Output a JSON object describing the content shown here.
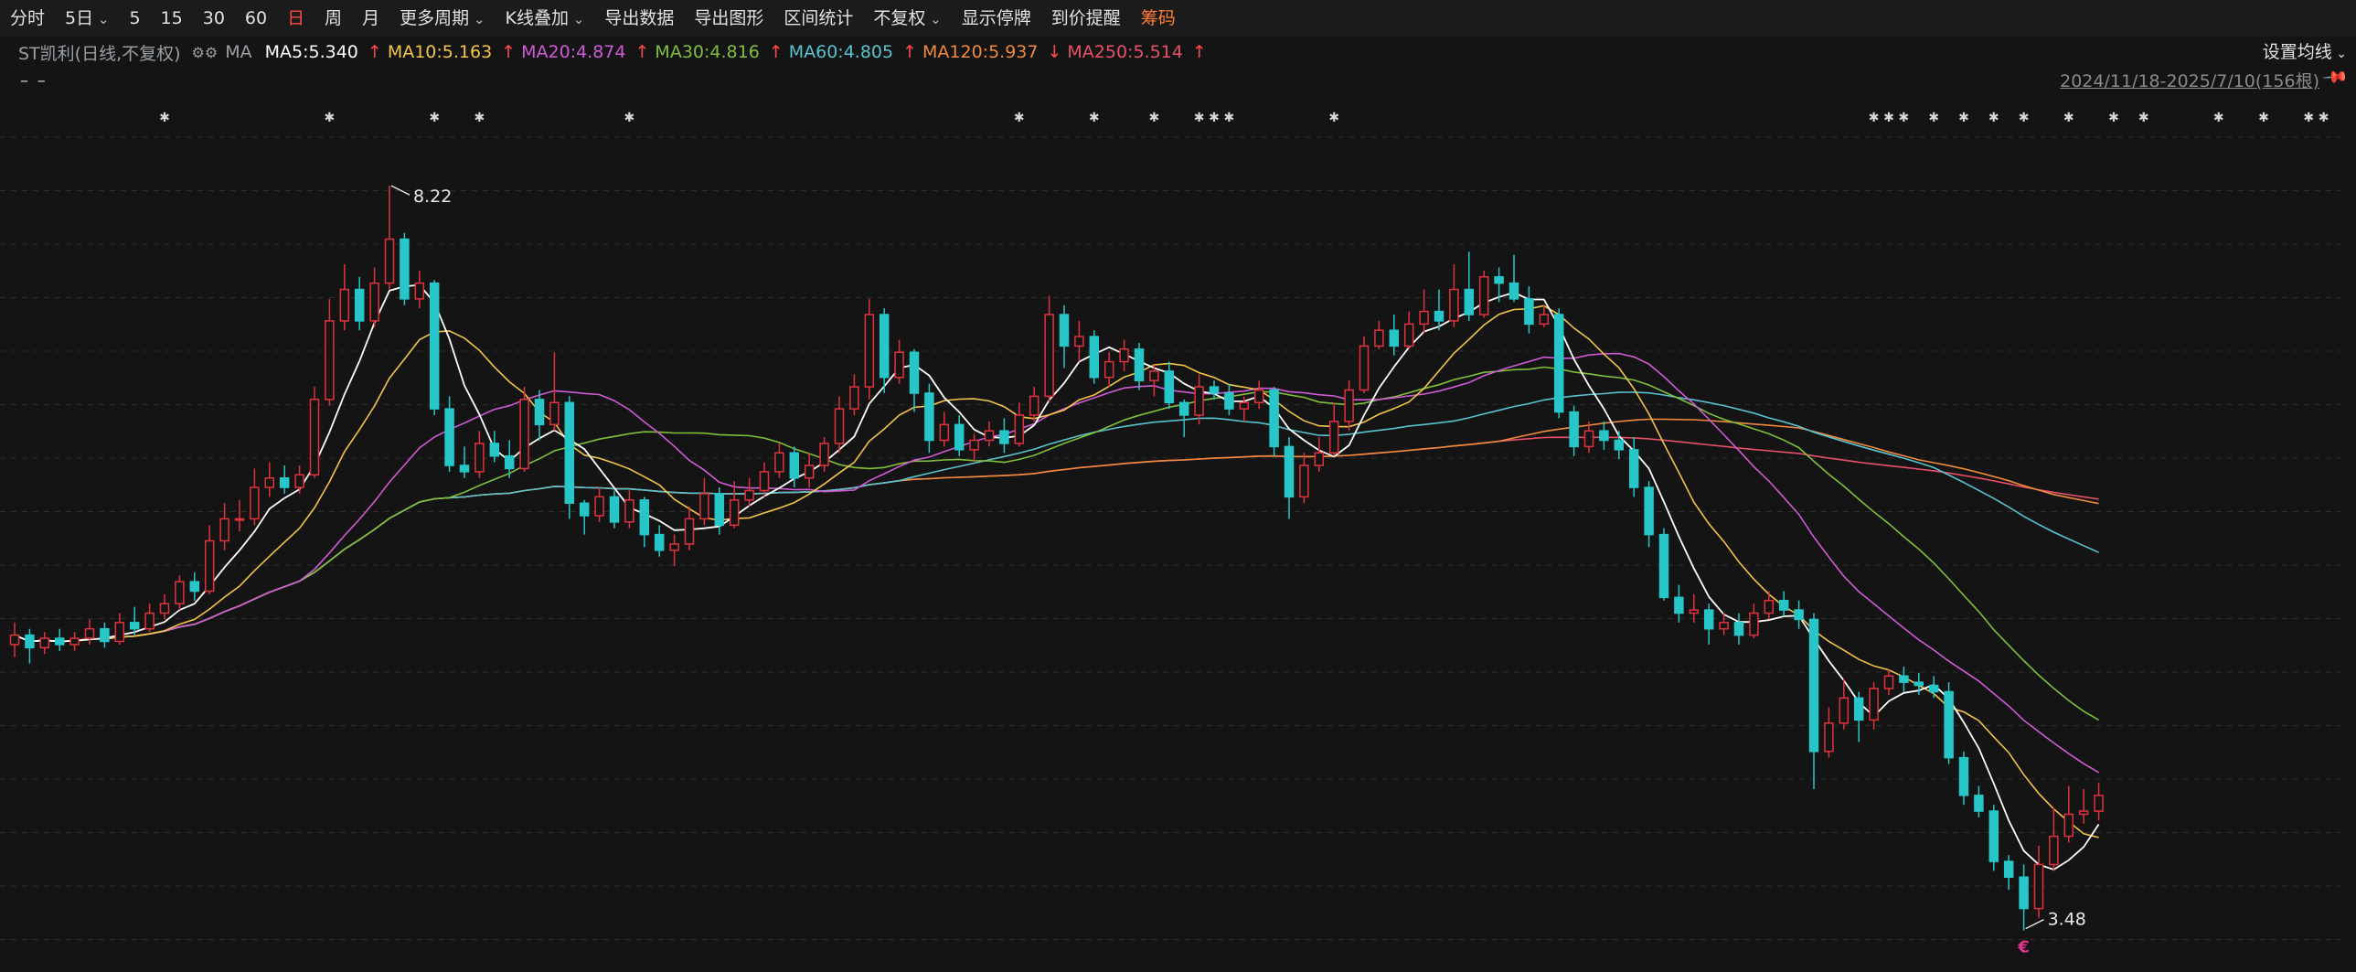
{
  "toolbar": {
    "items": [
      {
        "label": "分时",
        "dropdown": false,
        "state": "normal"
      },
      {
        "label": "5日",
        "dropdown": true,
        "state": "normal"
      },
      {
        "label": "5",
        "dropdown": false,
        "state": "normal"
      },
      {
        "label": "15",
        "dropdown": false,
        "state": "normal"
      },
      {
        "label": "30",
        "dropdown": false,
        "state": "normal"
      },
      {
        "label": "60",
        "dropdown": false,
        "state": "normal"
      },
      {
        "label": "日",
        "dropdown": false,
        "state": "active"
      },
      {
        "label": "周",
        "dropdown": false,
        "state": "normal"
      },
      {
        "label": "月",
        "dropdown": false,
        "state": "normal"
      },
      {
        "label": "更多周期",
        "dropdown": true,
        "state": "normal"
      },
      {
        "label": "K线叠加",
        "dropdown": true,
        "state": "normal"
      },
      {
        "label": "导出数据",
        "dropdown": false,
        "state": "normal"
      },
      {
        "label": "导出图形",
        "dropdown": false,
        "state": "normal"
      },
      {
        "label": "区间统计",
        "dropdown": false,
        "state": "normal"
      },
      {
        "label": "不复权",
        "dropdown": true,
        "state": "normal"
      },
      {
        "label": "显示停牌",
        "dropdown": false,
        "state": "normal"
      },
      {
        "label": "到价提醒",
        "dropdown": false,
        "state": "normal"
      },
      {
        "label": "筹码",
        "dropdown": false,
        "state": "highlight"
      }
    ]
  },
  "info": {
    "stock": "ST凯利(日线,不复权)",
    "gear_icon": "gear-icon",
    "ma_tag": "MA",
    "ma_items": [
      {
        "text": "MA5:5.340",
        "arrow": "↑",
        "color": "#ffffff"
      },
      {
        "text": "MA10:5.163",
        "arrow": "↑",
        "color": "#f2c447"
      },
      {
        "text": "MA20:4.874",
        "arrow": "↑",
        "color": "#d15ad6"
      },
      {
        "text": "MA30:4.816",
        "arrow": "↑",
        "color": "#7fbf3a"
      },
      {
        "text": "MA60:4.805",
        "arrow": "↑",
        "color": "#58c3cf"
      },
      {
        "text": "MA120:5.937",
        "arrow": "↓",
        "color": "#f08a3c"
      },
      {
        "text": "MA250:5.514",
        "arrow": "↑",
        "color": "#e8506a"
      }
    ],
    "set_ma": "设置均线",
    "range": "2024/11/18-2025/7/10(156根)",
    "dash": "– –"
  },
  "chart_data": {
    "type": "candlestick",
    "count": 156,
    "y_range": [
      3.35,
      8.5
    ],
    "high_label": "8.22",
    "low_label": "3.48",
    "low_marker": "€",
    "up_color": "#e0323c",
    "down_color": "#26c6c9",
    "grid": "dashed horizontal",
    "series_colors": {
      "MA5": "#ffffff",
      "MA10": "#f2c447",
      "MA20": "#d15ad6",
      "MA30": "#7fbf3a",
      "MA60": "#58c3cf",
      "MA120": "#f08a3c",
      "MA250": "#e8506a"
    },
    "ohlc": [
      [
        5.3,
        5.36,
        5.44,
        5.22
      ],
      [
        5.36,
        5.28,
        5.4,
        5.18
      ],
      [
        5.28,
        5.34,
        5.38,
        5.24
      ],
      [
        5.34,
        5.3,
        5.4,
        5.26
      ],
      [
        5.3,
        5.34,
        5.38,
        5.26
      ],
      [
        5.34,
        5.4,
        5.46,
        5.3
      ],
      [
        5.4,
        5.32,
        5.44,
        5.28
      ],
      [
        5.32,
        5.44,
        5.5,
        5.3
      ],
      [
        5.44,
        5.4,
        5.54,
        5.36
      ],
      [
        5.4,
        5.5,
        5.56,
        5.38
      ],
      [
        5.5,
        5.56,
        5.62,
        5.46
      ],
      [
        5.56,
        5.7,
        5.74,
        5.52
      ],
      [
        5.7,
        5.64,
        5.76,
        5.58
      ],
      [
        5.64,
        5.96,
        6.06,
        5.62
      ],
      [
        5.96,
        6.1,
        6.2,
        5.9
      ],
      [
        6.1,
        6.1,
        6.22,
        6.02
      ],
      [
        6.1,
        6.3,
        6.42,
        6.06
      ],
      [
        6.3,
        6.36,
        6.46,
        6.24
      ],
      [
        6.36,
        6.3,
        6.44,
        6.26
      ],
      [
        6.3,
        6.38,
        6.44,
        6.26
      ],
      [
        6.38,
        6.86,
        6.94,
        6.36
      ],
      [
        6.86,
        7.36,
        7.5,
        6.82
      ],
      [
        7.36,
        7.56,
        7.72,
        7.3
      ],
      [
        7.56,
        7.36,
        7.64,
        7.3
      ],
      [
        7.36,
        7.6,
        7.7,
        7.32
      ],
      [
        7.6,
        7.88,
        8.22,
        7.56
      ],
      [
        7.88,
        7.5,
        7.92,
        7.46
      ],
      [
        7.5,
        7.6,
        7.68,
        7.44
      ],
      [
        7.6,
        6.8,
        7.62,
        6.76
      ],
      [
        6.8,
        6.44,
        6.88,
        6.4
      ],
      [
        6.44,
        6.4,
        6.56,
        6.36
      ],
      [
        6.4,
        6.58,
        6.66,
        6.36
      ],
      [
        6.58,
        6.5,
        6.66,
        6.46
      ],
      [
        6.5,
        6.42,
        6.6,
        6.36
      ],
      [
        6.42,
        6.86,
        6.94,
        6.4
      ],
      [
        6.86,
        6.7,
        6.92,
        6.6
      ],
      [
        6.7,
        6.84,
        7.16,
        6.66
      ],
      [
        6.84,
        6.2,
        6.88,
        6.1
      ],
      [
        6.2,
        6.12,
        6.22,
        6.0
      ],
      [
        6.12,
        6.24,
        6.3,
        6.08
      ],
      [
        6.24,
        6.08,
        6.28,
        6.04
      ],
      [
        6.08,
        6.22,
        6.28,
        6.04
      ],
      [
        6.22,
        6.0,
        6.24,
        5.92
      ],
      [
        6.0,
        5.9,
        6.06,
        5.86
      ],
      [
        5.9,
        5.94,
        6.0,
        5.8
      ],
      [
        5.94,
        6.1,
        6.18,
        5.9
      ],
      [
        6.1,
        6.26,
        6.36,
        6.06
      ],
      [
        6.26,
        6.06,
        6.3,
        6.0
      ],
      [
        6.06,
        6.22,
        6.34,
        6.04
      ],
      [
        6.22,
        6.28,
        6.36,
        6.18
      ],
      [
        6.28,
        6.4,
        6.46,
        6.24
      ],
      [
        6.4,
        6.52,
        6.58,
        6.36
      ],
      [
        6.52,
        6.36,
        6.56,
        6.3
      ],
      [
        6.36,
        6.44,
        6.52,
        6.3
      ],
      [
        6.44,
        6.58,
        6.62,
        6.4
      ],
      [
        6.58,
        6.8,
        6.88,
        6.52
      ],
      [
        6.8,
        6.94,
        7.02,
        6.76
      ],
      [
        6.94,
        7.4,
        7.5,
        6.86
      ],
      [
        7.4,
        7.0,
        7.44,
        6.9
      ],
      [
        7.0,
        7.16,
        7.24,
        6.96
      ],
      [
        7.16,
        6.9,
        7.18,
        6.78
      ],
      [
        6.9,
        6.6,
        6.96,
        6.52
      ],
      [
        6.6,
        6.7,
        6.78,
        6.56
      ],
      [
        6.7,
        6.54,
        6.76,
        6.5
      ],
      [
        6.54,
        6.6,
        6.64,
        6.46
      ],
      [
        6.6,
        6.66,
        6.72,
        6.56
      ],
      [
        6.66,
        6.58,
        6.74,
        6.52
      ],
      [
        6.58,
        6.76,
        6.84,
        6.56
      ],
      [
        6.76,
        6.88,
        6.94,
        6.72
      ],
      [
        6.88,
        7.4,
        7.52,
        6.84
      ],
      [
        7.4,
        7.2,
        7.46,
        7.06
      ],
      [
        7.2,
        7.26,
        7.36,
        7.1
      ],
      [
        7.26,
        7.0,
        7.3,
        6.96
      ],
      [
        7.0,
        7.1,
        7.16,
        6.94
      ],
      [
        7.1,
        7.18,
        7.24,
        7.04
      ],
      [
        7.18,
        6.98,
        7.22,
        6.92
      ],
      [
        6.98,
        7.04,
        7.08,
        6.88
      ],
      [
        7.04,
        6.84,
        7.1,
        6.8
      ],
      [
        6.84,
        6.76,
        6.86,
        6.62
      ],
      [
        6.76,
        6.94,
        7.02,
        6.7
      ],
      [
        6.94,
        6.9,
        6.98,
        6.86
      ],
      [
        6.9,
        6.8,
        6.96,
        6.76
      ],
      [
        6.8,
        6.84,
        6.88,
        6.72
      ],
      [
        6.84,
        6.92,
        6.98,
        6.8
      ],
      [
        6.92,
        6.56,
        6.94,
        6.5
      ],
      [
        6.56,
        6.24,
        6.62,
        6.1
      ],
      [
        6.24,
        6.44,
        6.52,
        6.2
      ],
      [
        6.44,
        6.52,
        6.62,
        6.4
      ],
      [
        6.52,
        6.72,
        6.84,
        6.5
      ],
      [
        6.72,
        6.92,
        6.98,
        6.66
      ],
      [
        6.92,
        7.2,
        7.26,
        6.9
      ],
      [
        7.2,
        7.3,
        7.36,
        7.18
      ],
      [
        7.3,
        7.2,
        7.4,
        7.14
      ],
      [
        7.2,
        7.34,
        7.42,
        7.18
      ],
      [
        7.34,
        7.42,
        7.56,
        7.28
      ],
      [
        7.42,
        7.36,
        7.56,
        7.3
      ],
      [
        7.36,
        7.56,
        7.72,
        7.32
      ],
      [
        7.56,
        7.4,
        7.8,
        7.36
      ],
      [
        7.4,
        7.64,
        7.68,
        7.38
      ],
      [
        7.64,
        7.6,
        7.7,
        7.48
      ],
      [
        7.6,
        7.5,
        7.78,
        7.48
      ],
      [
        7.5,
        7.34,
        7.58,
        7.28
      ],
      [
        7.34,
        7.4,
        7.46,
        7.32
      ],
      [
        7.4,
        6.78,
        7.44,
        6.74
      ],
      [
        6.78,
        6.56,
        6.82,
        6.5
      ],
      [
        6.56,
        6.66,
        6.72,
        6.52
      ],
      [
        6.66,
        6.6,
        6.72,
        6.54
      ],
      [
        6.6,
        6.54,
        6.66,
        6.48
      ],
      [
        6.54,
        6.3,
        6.62,
        6.24
      ],
      [
        6.3,
        6.0,
        6.34,
        5.92
      ],
      [
        6.0,
        5.6,
        6.04,
        5.58
      ],
      [
        5.6,
        5.5,
        5.68,
        5.44
      ],
      [
        5.5,
        5.52,
        5.62,
        5.44
      ],
      [
        5.52,
        5.4,
        5.56,
        5.3
      ],
      [
        5.4,
        5.44,
        5.5,
        5.36
      ],
      [
        5.44,
        5.36,
        5.5,
        5.3
      ],
      [
        5.36,
        5.5,
        5.56,
        5.34
      ],
      [
        5.5,
        5.58,
        5.64,
        5.46
      ],
      [
        5.58,
        5.52,
        5.64,
        5.48
      ],
      [
        5.52,
        5.46,
        5.58,
        5.4
      ],
      [
        5.46,
        4.62,
        5.5,
        4.38
      ],
      [
        4.62,
        4.8,
        4.9,
        4.58
      ],
      [
        4.8,
        4.96,
        5.08,
        4.76
      ],
      [
        4.96,
        4.82,
        5.0,
        4.68
      ],
      [
        4.82,
        5.02,
        5.06,
        4.76
      ],
      [
        5.02,
        5.1,
        5.14,
        4.98
      ],
      [
        5.1,
        5.06,
        5.16,
        5.0
      ],
      [
        5.06,
        5.04,
        5.12,
        4.98
      ],
      [
        5.04,
        5.0,
        5.1,
        4.96
      ],
      [
        5.0,
        4.58,
        5.06,
        4.54
      ],
      [
        4.58,
        4.34,
        4.62,
        4.28
      ],
      [
        4.34,
        4.24,
        4.4,
        4.2
      ],
      [
        4.24,
        3.92,
        4.28,
        3.86
      ],
      [
        3.92,
        3.82,
        3.96,
        3.74
      ],
      [
        3.82,
        3.62,
        3.9,
        3.48
      ],
      [
        3.62,
        3.9,
        4.02,
        3.56
      ],
      [
        3.9,
        4.08,
        4.26,
        3.86
      ],
      [
        4.08,
        4.22,
        4.4,
        4.04
      ],
      [
        4.22,
        4.24,
        4.38,
        4.16
      ],
      [
        4.24,
        4.34,
        4.42,
        4.18
      ]
    ]
  }
}
